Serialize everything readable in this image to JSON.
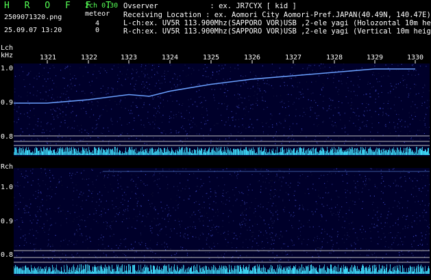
{
  "header": {
    "logo": "H R O F F T",
    "version": "2ch 0.30",
    "filename": "2509071320.png",
    "timestamp": "25.09.07 13:20",
    "meteor_label": "meteor",
    "meteor_lch": "4",
    "meteor_rch": "0",
    "observer": "Ovserver            : ex. JR7CYX [ kid ]",
    "location": "Receiving Location : ex. Aomori City Aomori-Pref.JAPAN(40.49N, 140.47E)",
    "lch_info": "L-ch:ex. UV5R 113.900Mhz(SAPPORO VOR)USB ,2-ele yagi (Holozontal 10m height)",
    "rch_info": "R-ch:ex. UV5R 113.900Mhz(SAPPORO VOR)USB ,2-ele yagi (Vertical 10m height)"
  },
  "time_axis": [
    "1321",
    "1322",
    "1323",
    "1324",
    "1325",
    "1326",
    "1327",
    "1328",
    "1329",
    "1330"
  ],
  "lch": {
    "label": "Lch",
    "unit": "kHz",
    "y_ticks": [
      "1.0",
      "0.9",
      "0.8"
    ]
  },
  "rch": {
    "label": "Rch",
    "y_ticks": [
      "1.0",
      "0.9",
      "0.8"
    ]
  },
  "colors": {
    "background": "#000000",
    "spectrum_bg": "#00002a",
    "trace": "#6aa0ff",
    "noise_band": "#40e0ff",
    "logo_green": "#55ff55",
    "grid_line": "#c0c0c0"
  },
  "chart_data": {
    "type": "heatmap",
    "lch_trace_time": [
      "1320",
      "1321",
      "1322",
      "1323",
      "1323.5",
      "1324",
      "1325",
      "1326",
      "1327",
      "1328",
      "1329",
      "1330"
    ],
    "lch_trace_khz": [
      0.9,
      0.9,
      0.91,
      0.925,
      0.92,
      0.935,
      0.955,
      0.97,
      0.98,
      0.99,
      1.0,
      1.0
    ],
    "rch_trace_khz_near": 1.0
  }
}
